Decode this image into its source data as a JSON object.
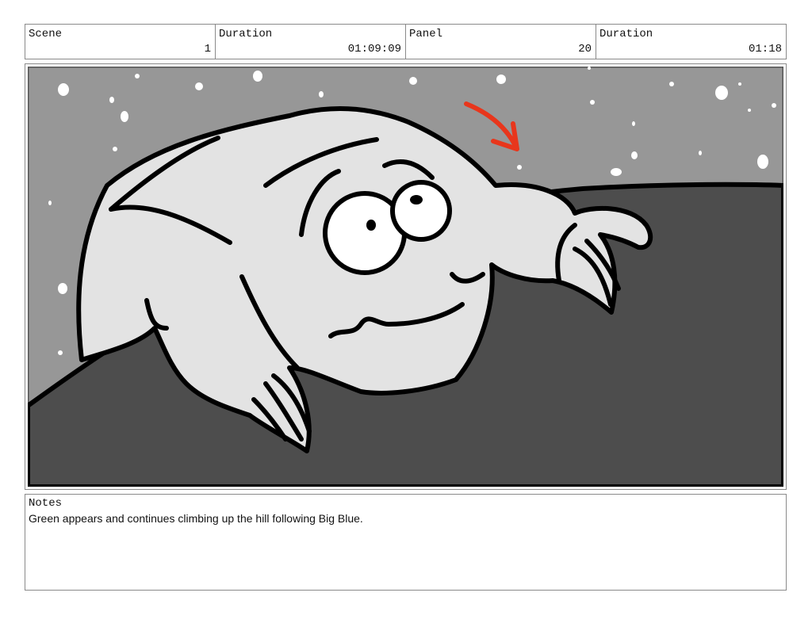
{
  "header": {
    "scene_label": "Scene",
    "scene_value": "1",
    "duration_label": "Duration",
    "duration_value": "01:09:09",
    "panel_label": "Panel",
    "panel_value": "20",
    "panel_duration_label": "Duration",
    "panel_duration_value": "01:18"
  },
  "notes": {
    "label": "Notes",
    "text": "Green appears and continues climbing up the hill following Big Blue."
  },
  "colors": {
    "sky": "#979797",
    "hill": "#4d4d4d",
    "creature": "#e3e3e3",
    "arrow": "#e8361c"
  }
}
